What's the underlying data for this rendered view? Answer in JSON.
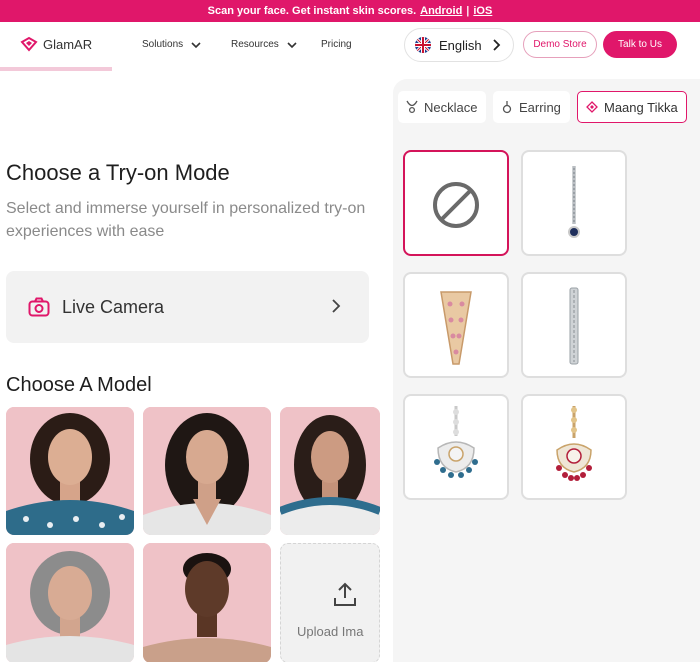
{
  "announcement": {
    "text": "Scan your face. Get instant skin scores.",
    "android": "Android",
    "sep": "|",
    "ios": "iOS"
  },
  "header": {
    "logo": "GlamAR",
    "nav": [
      {
        "label": "Solutions"
      },
      {
        "label": "Resources"
      },
      {
        "label": "Pricing"
      }
    ],
    "language": "English",
    "demo_button": "Demo Store",
    "talk_button": "Talk to Us"
  },
  "main": {
    "title": "Choose a Try-on Mode",
    "subtitle": "Select and immerse yourself in personalized try-on experiences with ease",
    "live_camera": "Live Camera",
    "model_title": "Choose A Model",
    "upload_label": "Upload Ima"
  },
  "tabs": [
    {
      "label": "Necklace",
      "icon": "necklace-icon",
      "active": false
    },
    {
      "label": "Earring",
      "icon": "earring-icon",
      "active": false
    },
    {
      "label": "Maang Tikka",
      "icon": "diamond-icon",
      "active": true
    }
  ],
  "colors": {
    "brand": "#e0176a",
    "panel": "#f5f5f5",
    "model_bg": "#efc2c7"
  }
}
